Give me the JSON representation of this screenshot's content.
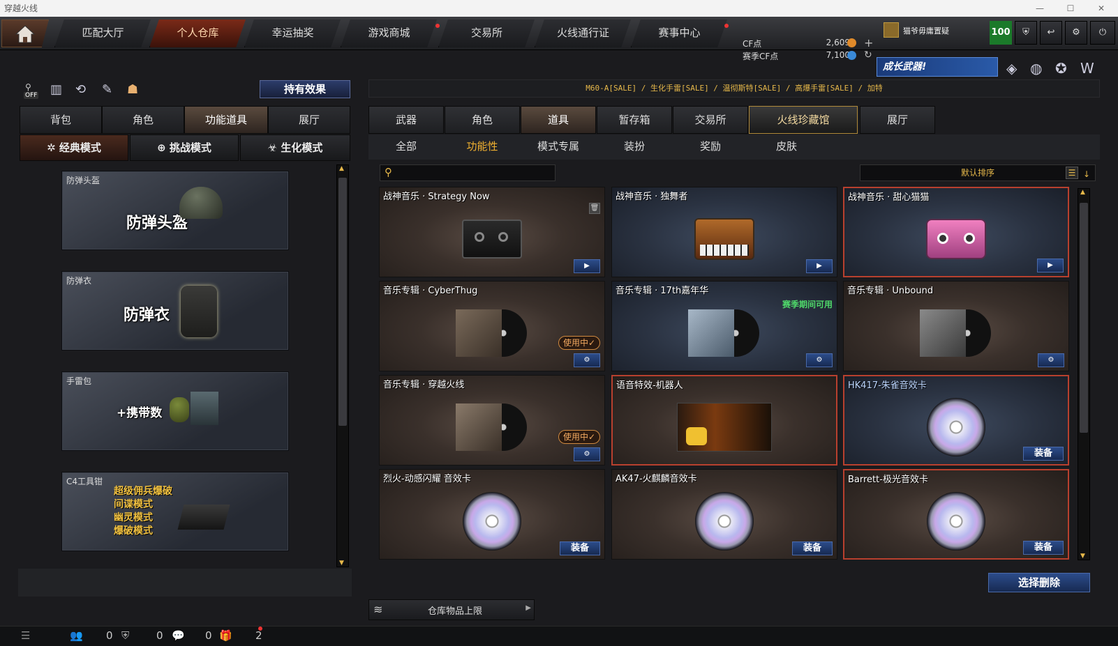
{
  "window": {
    "title": "穿越火线"
  },
  "nav": {
    "tabs": [
      {
        "label": "匹配大厅"
      },
      {
        "label": "个人仓库"
      },
      {
        "label": "幸运抽奖"
      },
      {
        "label": "游戏商城"
      },
      {
        "label": "交易所"
      },
      {
        "label": "火线通行证"
      },
      {
        "label": "赛事中心"
      }
    ],
    "active": "个人仓库"
  },
  "currency": {
    "cf_label": "CF点",
    "cf_value": "2,609",
    "season_label": "赛季CF点",
    "season_value": "7,100"
  },
  "user": {
    "name": "猫爷毋庸置疑",
    "level": "100"
  },
  "banner": {
    "text": "成长武器!"
  },
  "left": {
    "effects_button": "持有效果",
    "off_badge": "OFF",
    "tabs": [
      "背包",
      "角色",
      "功能道具",
      "展厅"
    ],
    "active_tab": "功能道具",
    "modes": [
      "经典模式",
      "挑战模式",
      "生化模式"
    ],
    "active_mode": "经典模式",
    "items": [
      {
        "label": "防弹头盔",
        "big": "防弹头盔"
      },
      {
        "label": "防弹衣",
        "big": "防弹衣"
      },
      {
        "label": "手雷包",
        "big": "+携带数"
      },
      {
        "label": "C4工具钳",
        "big_lines": [
          "超级佣兵爆破",
          "间谍模式",
          "幽灵模式",
          "爆破模式"
        ]
      }
    ]
  },
  "right": {
    "sale_bar": "M60-A[SALE] / 生化手雷[SALE] / 温彻斯特[SALE] / 高爆手雷[SALE] / 加特",
    "tabs": [
      "武器",
      "角色",
      "道具",
      "暂存箱",
      "交易所",
      "火线珍藏馆",
      "展厅"
    ],
    "active_tab": "道具",
    "gold_tab": "火线珍藏馆",
    "subtabs": [
      "全部",
      "功能性",
      "模式专属",
      "装扮",
      "奖励",
      "皮肤"
    ],
    "active_subtab": "功能性",
    "search_placeholder": "",
    "sort_label": "默认排序",
    "cards": [
      {
        "name": "战神音乐 · Strategy Now"
      },
      {
        "name": "战神音乐 · 独舞者"
      },
      {
        "name": "战神音乐 · 甜心猫猫"
      },
      {
        "name": "音乐专辑 · CyberThug",
        "status": "使用中✓"
      },
      {
        "name": "音乐专辑 · 17th嘉年华",
        "note": "赛季期间可用"
      },
      {
        "name": "音乐专辑 · Unbound"
      },
      {
        "name": "音乐专辑 · 穿越火线",
        "status": "使用中✓"
      },
      {
        "name": "语音特效-机器人"
      },
      {
        "name": "HK417-朱雀音效卡",
        "action": "装备"
      },
      {
        "name": "烈火-动感闪耀 音效卡",
        "action": "装备"
      },
      {
        "name": "AK47-火麒麟音效卡",
        "action": "装备"
      },
      {
        "name": "Barrett-极光音效卡",
        "action": "装备"
      }
    ],
    "storage_label": "仓库物品上限",
    "delete_button": "选择删除"
  },
  "status": {
    "friends": "0",
    "guild": "0",
    "messages": "0",
    "gifts": "2"
  },
  "colors": {
    "accent_gold": "#e6b84a",
    "active_orange": "#f0b030",
    "button_blue": "#2c4c8a",
    "highlight_red": "#b8402e"
  }
}
